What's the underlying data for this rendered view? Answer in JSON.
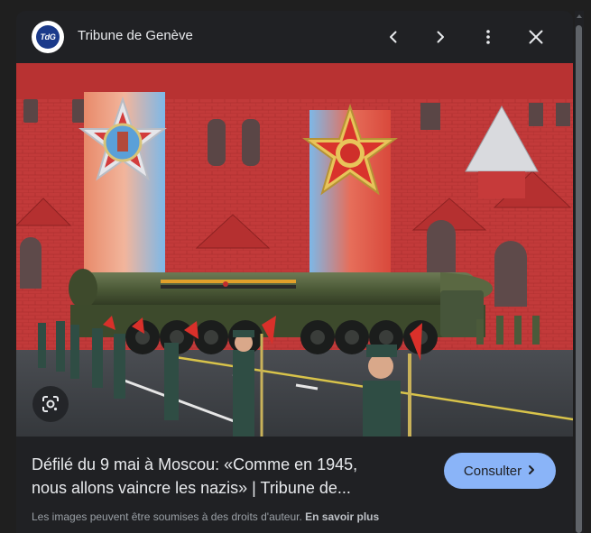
{
  "header": {
    "favicon_text": "TdG",
    "source_name": "Tribune de Genève",
    "icons": {
      "prev": "chevron-left-icon",
      "next": "chevron-right-icon",
      "more": "more-vert-icon",
      "close": "close-icon"
    }
  },
  "image": {
    "icon": "lens-icon"
  },
  "result": {
    "title_line1": "Défilé du 9 mai à Moscou: «Comme en 1945,",
    "title_line2": "nous allons vaincre les nazis» | Tribune de...",
    "visit_label": "Consulter",
    "visit_icon": "chevron-right-icon"
  },
  "notice": {
    "text": "Les images peuvent être soumises à des droits d'auteur.",
    "learn_more": "En savoir plus"
  },
  "colors": {
    "panel_bg": "#202124",
    "page_bg": "#1f1f1f",
    "accent": "#8ab4f8",
    "text_primary": "#e8eaed",
    "text_secondary": "#9aa0a6"
  }
}
